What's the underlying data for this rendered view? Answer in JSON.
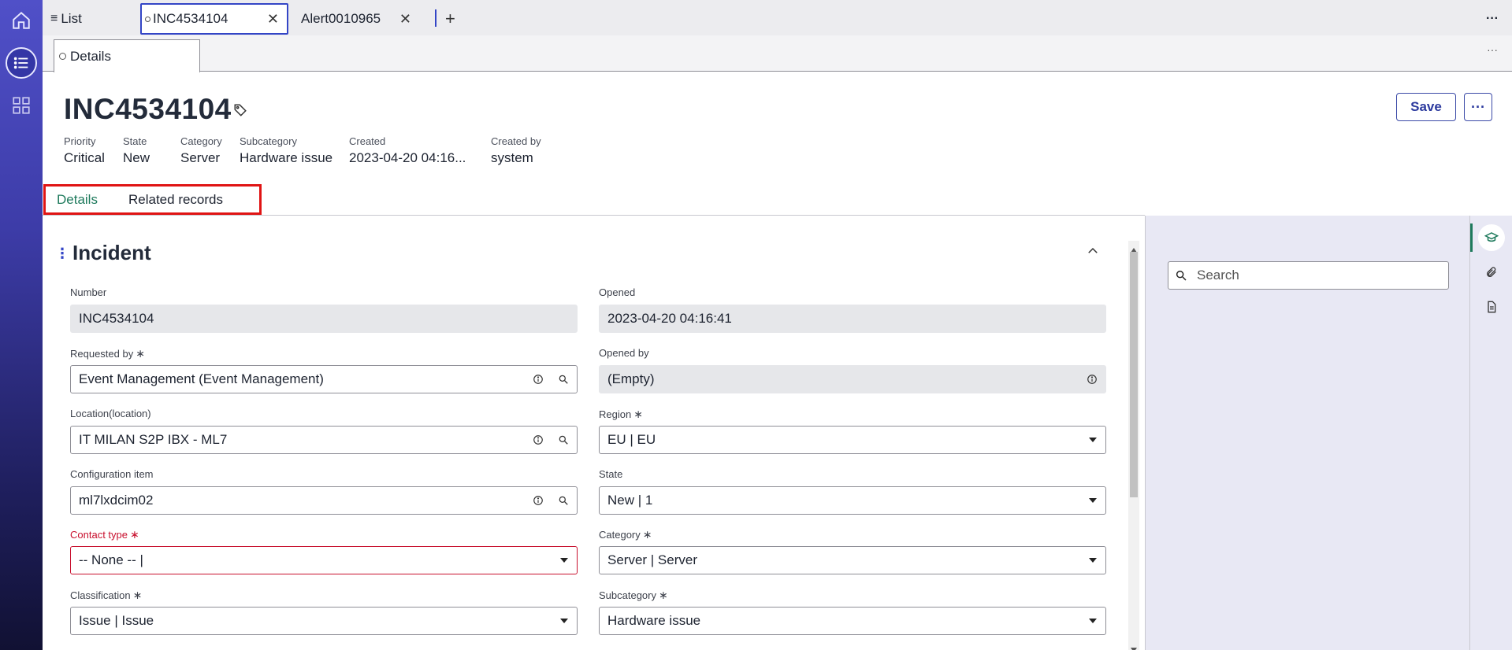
{
  "rail": {
    "items": [
      {
        "icon": "home-icon"
      },
      {
        "icon": "list-icon",
        "active": true
      },
      {
        "icon": "grid-icon"
      }
    ]
  },
  "top_tabs": {
    "list_label": "List",
    "tabs": [
      {
        "label": "INC4534104",
        "active": true
      },
      {
        "label": "Alert0010965",
        "active": false
      }
    ],
    "add_label": "+",
    "more_label": "···"
  },
  "sub_tabs": {
    "details_label": "Details",
    "more_label": "···"
  },
  "record": {
    "number": "INC4534104",
    "meta": [
      {
        "label": "Priority",
        "value": "Critical"
      },
      {
        "label": "State",
        "value": "New"
      },
      {
        "label": "Category",
        "value": "Server"
      },
      {
        "label": "Subcategory",
        "value": "Hardware issue"
      },
      {
        "label": "Created",
        "value": "2023-04-20 04:16..."
      },
      {
        "label": "Created by",
        "value": "system"
      }
    ],
    "save_label": "Save",
    "more_label": "···"
  },
  "content_tabs": {
    "details": "Details",
    "related": "Related records"
  },
  "form": {
    "section_title": "Incident",
    "required_mark": "∗",
    "left": [
      {
        "label": "Number",
        "value": "INC4534104",
        "readonly": true
      },
      {
        "label": "Requested by",
        "value": "Event Management (Event Management)",
        "required": true,
        "type": "reference"
      },
      {
        "label": "Location(location)",
        "value": "IT MILAN S2P IBX - ML7",
        "type": "reference"
      },
      {
        "label": "Configuration item",
        "value": "ml7lxdcim02",
        "type": "reference"
      },
      {
        "label": "Contact type",
        "value": "-- None -- |",
        "required": true,
        "type": "select",
        "error": true
      },
      {
        "label": "Classification",
        "value": "Issue | Issue",
        "required": true,
        "type": "select"
      }
    ],
    "right": [
      {
        "label": "Opened",
        "value": "2023-04-20 04:16:41",
        "readonly": true
      },
      {
        "label": "Opened by",
        "value": "(Empty)",
        "readonly": true,
        "type": "info"
      },
      {
        "label": "Region",
        "value": "EU | EU",
        "required": true,
        "type": "select"
      },
      {
        "label": "State",
        "value": "New | 1",
        "type": "select"
      },
      {
        "label": "Category",
        "value": "Server | Server",
        "required": true,
        "type": "select"
      },
      {
        "label": "Subcategory",
        "value": "Hardware issue",
        "required": true,
        "type": "select"
      }
    ]
  },
  "right_panel": {
    "search_placeholder": "Search"
  },
  "colors": {
    "accent": "#3345c6",
    "error": "#c8102e",
    "tab_selected": "#1e7a5c",
    "highlight": "#e01414"
  }
}
